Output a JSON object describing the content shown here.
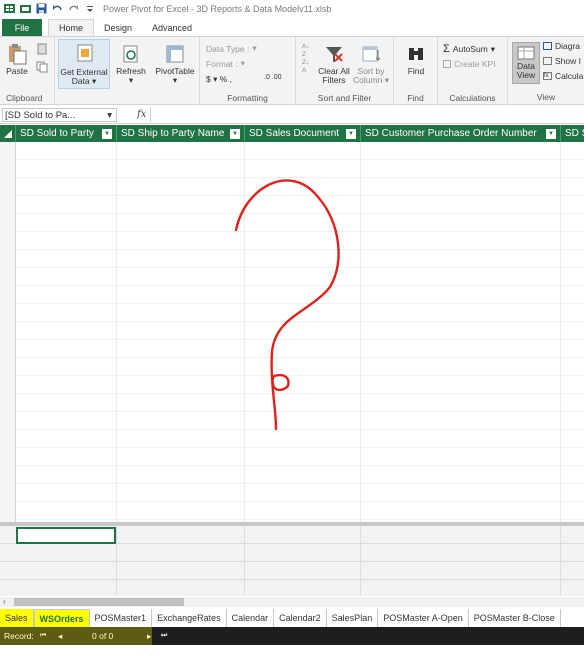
{
  "title_bar": {
    "title": "Power Pivot for Excel - 3D Reports & Data Modelv11.xlsb"
  },
  "ribbon_tabs": [
    "File",
    "Home",
    "Design",
    "Advanced"
  ],
  "ribbon": {
    "clipboard": {
      "paste": "Paste",
      "group": "Clipboard"
    },
    "get_external": {
      "line1": "Get External",
      "line2": "Data"
    },
    "refresh": {
      "label": "Refresh"
    },
    "pivottable": {
      "label": "PivotTable"
    },
    "formatting": {
      "data_type": "Data Type :",
      "format": "Format :",
      "symbols": "$ ▾  %  ,",
      "decimals": ".0 .00",
      "group": "Formatting"
    },
    "sort_filter": {
      "clear_line1": "Clear All",
      "clear_line2": "Filters",
      "sortby_line1": "Sort by",
      "sortby_line2": "Column",
      "group": "Sort and Filter"
    },
    "find": {
      "label": "Find",
      "group": "Find"
    },
    "calculations": {
      "autosum": "AutoSum",
      "create_kpi": "Create KPI",
      "group": "Calculations"
    },
    "view": {
      "dataview_line1": "Data",
      "dataview_line2": "View",
      "diagram": "Diagra",
      "show": "Show I",
      "calcul": "Calcula",
      "group": "View"
    }
  },
  "formula_bar": {
    "name_box": "[SD Sold to Pa...",
    "fx": "fx"
  },
  "grid": {
    "columns": [
      "SD Sold to Party",
      "SD Ship to Party Name",
      "SD Sales Document",
      "SD Customer Purchase Order Number",
      "SD S"
    ]
  },
  "sheet_tabs": [
    "Sales",
    "WSOrders",
    "POSMaster1",
    "ExchangeRates",
    "Calendar",
    "Calendar2",
    "SalesPlan",
    "POSMaster A-Open",
    "POSMaster B-Close"
  ],
  "record_bar": {
    "label": "Record:",
    "first": "⏮",
    "prev": "◂",
    "position": "0 of 0",
    "next": "▸",
    "last": "⏭"
  },
  "colors": {
    "accent": "#217346",
    "highlight": "#ffff00",
    "annotation": "#e0211c"
  }
}
